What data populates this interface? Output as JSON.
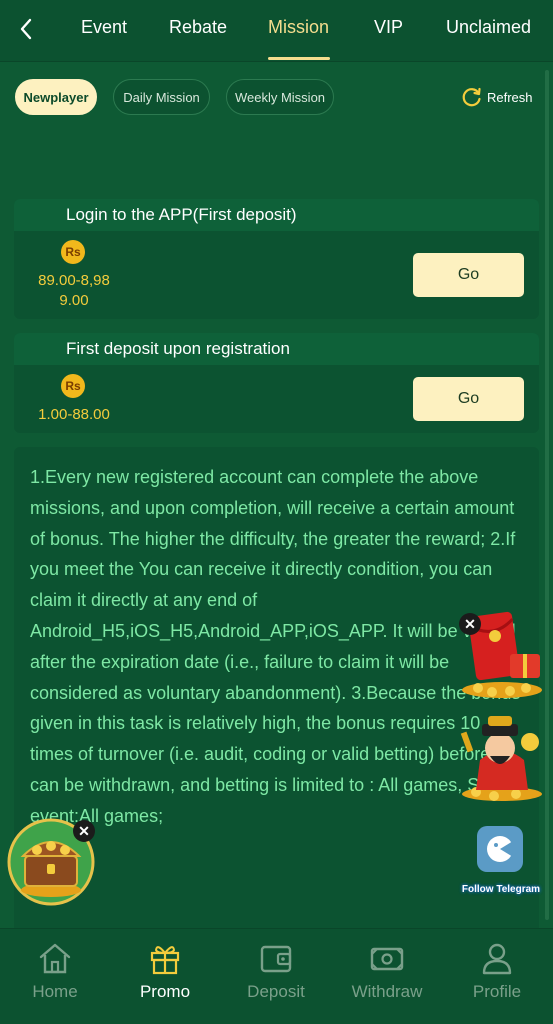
{
  "nav": {
    "tabs": [
      {
        "label": "Event"
      },
      {
        "label": "Rebate"
      },
      {
        "label": "Mission",
        "active": true
      },
      {
        "label": "VIP"
      },
      {
        "label": "Unclaimed"
      }
    ]
  },
  "subtabs": [
    {
      "label": "Newplayer",
      "active": true
    },
    {
      "label": "Daily Mission"
    },
    {
      "label": "Weekly Mission"
    }
  ],
  "refresh_label": "Refresh",
  "missions": [
    {
      "title": "Login to the APP(First deposit)",
      "currency": "Rs",
      "reward_line1": "89.00-8,98",
      "reward_line2": "9.00",
      "button": "Go"
    },
    {
      "title": "First deposit upon registration",
      "currency": "Rs",
      "reward_line1": "1.00-88.00",
      "button": "Go"
    }
  ],
  "rules_text": "1.Every new registered account can complete the above missions, and upon completion, will receive a certain amount of bonus. The higher the difficulty, the greater the reward; 2.If you meet the You can receive it directly condition, you can claim it directly at any end of Android_H5,iOS_H5,Android_APP,iOS_APP. It will be voided after the expiration date (i.e., failure to claim it will be considered as voluntary abandonment). 3.Because the bonus given in this task is relatively high, the bonus requires 10 times of turnover (i.e. audit, coding or valid betting) before it can be withdrawn, and betting is limited to : All games, Slot event:All games;",
  "widgets": {
    "telegram_label": "Follow Telegram",
    "close_symbol": "✕"
  },
  "bottom_nav": [
    {
      "label": "Home",
      "icon": "home-icon"
    },
    {
      "label": "Promo",
      "icon": "gift-icon",
      "active": true
    },
    {
      "label": "Deposit",
      "icon": "wallet-icon"
    },
    {
      "label": "Withdraw",
      "icon": "cash-icon"
    },
    {
      "label": "Profile",
      "icon": "user-icon"
    }
  ],
  "colors": {
    "background": "#0e5a34",
    "accent": "#f5dd8e",
    "button": "#fdf1c0",
    "reward": "#f3cc3c",
    "rules_text": "#7ee8a5"
  }
}
